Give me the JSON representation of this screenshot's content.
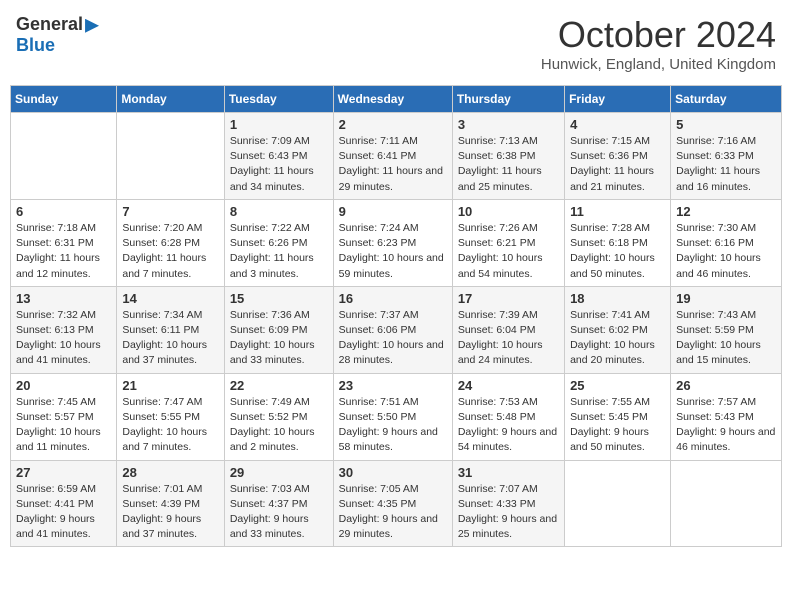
{
  "header": {
    "logo_general": "General",
    "logo_blue": "Blue",
    "month_title": "October 2024",
    "location": "Hunwick, England, United Kingdom"
  },
  "days_of_week": [
    "Sunday",
    "Monday",
    "Tuesday",
    "Wednesday",
    "Thursday",
    "Friday",
    "Saturday"
  ],
  "weeks": [
    [
      {
        "day": "",
        "sunrise": "",
        "sunset": "",
        "daylight": ""
      },
      {
        "day": "",
        "sunrise": "",
        "sunset": "",
        "daylight": ""
      },
      {
        "day": "1",
        "sunrise": "Sunrise: 7:09 AM",
        "sunset": "Sunset: 6:43 PM",
        "daylight": "Daylight: 11 hours and 34 minutes."
      },
      {
        "day": "2",
        "sunrise": "Sunrise: 7:11 AM",
        "sunset": "Sunset: 6:41 PM",
        "daylight": "Daylight: 11 hours and 29 minutes."
      },
      {
        "day": "3",
        "sunrise": "Sunrise: 7:13 AM",
        "sunset": "Sunset: 6:38 PM",
        "daylight": "Daylight: 11 hours and 25 minutes."
      },
      {
        "day": "4",
        "sunrise": "Sunrise: 7:15 AM",
        "sunset": "Sunset: 6:36 PM",
        "daylight": "Daylight: 11 hours and 21 minutes."
      },
      {
        "day": "5",
        "sunrise": "Sunrise: 7:16 AM",
        "sunset": "Sunset: 6:33 PM",
        "daylight": "Daylight: 11 hours and 16 minutes."
      }
    ],
    [
      {
        "day": "6",
        "sunrise": "Sunrise: 7:18 AM",
        "sunset": "Sunset: 6:31 PM",
        "daylight": "Daylight: 11 hours and 12 minutes."
      },
      {
        "day": "7",
        "sunrise": "Sunrise: 7:20 AM",
        "sunset": "Sunset: 6:28 PM",
        "daylight": "Daylight: 11 hours and 7 minutes."
      },
      {
        "day": "8",
        "sunrise": "Sunrise: 7:22 AM",
        "sunset": "Sunset: 6:26 PM",
        "daylight": "Daylight: 11 hours and 3 minutes."
      },
      {
        "day": "9",
        "sunrise": "Sunrise: 7:24 AM",
        "sunset": "Sunset: 6:23 PM",
        "daylight": "Daylight: 10 hours and 59 minutes."
      },
      {
        "day": "10",
        "sunrise": "Sunrise: 7:26 AM",
        "sunset": "Sunset: 6:21 PM",
        "daylight": "Daylight: 10 hours and 54 minutes."
      },
      {
        "day": "11",
        "sunrise": "Sunrise: 7:28 AM",
        "sunset": "Sunset: 6:18 PM",
        "daylight": "Daylight: 10 hours and 50 minutes."
      },
      {
        "day": "12",
        "sunrise": "Sunrise: 7:30 AM",
        "sunset": "Sunset: 6:16 PM",
        "daylight": "Daylight: 10 hours and 46 minutes."
      }
    ],
    [
      {
        "day": "13",
        "sunrise": "Sunrise: 7:32 AM",
        "sunset": "Sunset: 6:13 PM",
        "daylight": "Daylight: 10 hours and 41 minutes."
      },
      {
        "day": "14",
        "sunrise": "Sunrise: 7:34 AM",
        "sunset": "Sunset: 6:11 PM",
        "daylight": "Daylight: 10 hours and 37 minutes."
      },
      {
        "day": "15",
        "sunrise": "Sunrise: 7:36 AM",
        "sunset": "Sunset: 6:09 PM",
        "daylight": "Daylight: 10 hours and 33 minutes."
      },
      {
        "day": "16",
        "sunrise": "Sunrise: 7:37 AM",
        "sunset": "Sunset: 6:06 PM",
        "daylight": "Daylight: 10 hours and 28 minutes."
      },
      {
        "day": "17",
        "sunrise": "Sunrise: 7:39 AM",
        "sunset": "Sunset: 6:04 PM",
        "daylight": "Daylight: 10 hours and 24 minutes."
      },
      {
        "day": "18",
        "sunrise": "Sunrise: 7:41 AM",
        "sunset": "Sunset: 6:02 PM",
        "daylight": "Daylight: 10 hours and 20 minutes."
      },
      {
        "day": "19",
        "sunrise": "Sunrise: 7:43 AM",
        "sunset": "Sunset: 5:59 PM",
        "daylight": "Daylight: 10 hours and 15 minutes."
      }
    ],
    [
      {
        "day": "20",
        "sunrise": "Sunrise: 7:45 AM",
        "sunset": "Sunset: 5:57 PM",
        "daylight": "Daylight: 10 hours and 11 minutes."
      },
      {
        "day": "21",
        "sunrise": "Sunrise: 7:47 AM",
        "sunset": "Sunset: 5:55 PM",
        "daylight": "Daylight: 10 hours and 7 minutes."
      },
      {
        "day": "22",
        "sunrise": "Sunrise: 7:49 AM",
        "sunset": "Sunset: 5:52 PM",
        "daylight": "Daylight: 10 hours and 2 minutes."
      },
      {
        "day": "23",
        "sunrise": "Sunrise: 7:51 AM",
        "sunset": "Sunset: 5:50 PM",
        "daylight": "Daylight: 9 hours and 58 minutes."
      },
      {
        "day": "24",
        "sunrise": "Sunrise: 7:53 AM",
        "sunset": "Sunset: 5:48 PM",
        "daylight": "Daylight: 9 hours and 54 minutes."
      },
      {
        "day": "25",
        "sunrise": "Sunrise: 7:55 AM",
        "sunset": "Sunset: 5:45 PM",
        "daylight": "Daylight: 9 hours and 50 minutes."
      },
      {
        "day": "26",
        "sunrise": "Sunrise: 7:57 AM",
        "sunset": "Sunset: 5:43 PM",
        "daylight": "Daylight: 9 hours and 46 minutes."
      }
    ],
    [
      {
        "day": "27",
        "sunrise": "Sunrise: 6:59 AM",
        "sunset": "Sunset: 4:41 PM",
        "daylight": "Daylight: 9 hours and 41 minutes."
      },
      {
        "day": "28",
        "sunrise": "Sunrise: 7:01 AM",
        "sunset": "Sunset: 4:39 PM",
        "daylight": "Daylight: 9 hours and 37 minutes."
      },
      {
        "day": "29",
        "sunrise": "Sunrise: 7:03 AM",
        "sunset": "Sunset: 4:37 PM",
        "daylight": "Daylight: 9 hours and 33 minutes."
      },
      {
        "day": "30",
        "sunrise": "Sunrise: 7:05 AM",
        "sunset": "Sunset: 4:35 PM",
        "daylight": "Daylight: 9 hours and 29 minutes."
      },
      {
        "day": "31",
        "sunrise": "Sunrise: 7:07 AM",
        "sunset": "Sunset: 4:33 PM",
        "daylight": "Daylight: 9 hours and 25 minutes."
      },
      {
        "day": "",
        "sunrise": "",
        "sunset": "",
        "daylight": ""
      },
      {
        "day": "",
        "sunrise": "",
        "sunset": "",
        "daylight": ""
      }
    ]
  ]
}
